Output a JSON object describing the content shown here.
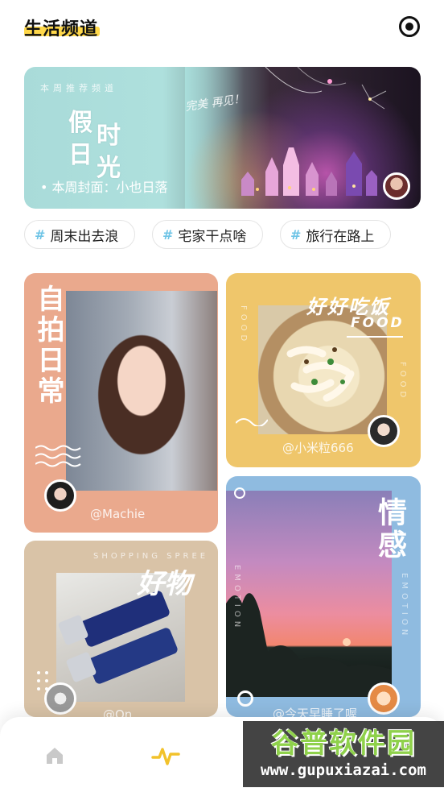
{
  "header": {
    "title": "生活频道",
    "record_icon": "record-icon"
  },
  "banner": {
    "eyebrow": "本周推荐频道",
    "headline_chars": [
      "假",
      "时",
      "日",
      "光"
    ],
    "script": "完美 再见！",
    "caption": "• 本周封面：小也日落"
  },
  "tags": [
    {
      "label": "周末出去浪"
    },
    {
      "label": "宅家干点啥"
    },
    {
      "label": "旅行在路上"
    }
  ],
  "cards": {
    "selfie": {
      "title": "自拍日常",
      "handle": "@Machie",
      "color": "#e9a98c"
    },
    "food": {
      "title": "好好吃饭",
      "subtitle": "FOOD",
      "side_text": "FOOD",
      "handle": "@小米粒666",
      "color": "#efc66a"
    },
    "goods": {
      "title": "好物",
      "subtitle": "SHOPPING SPREE",
      "handle": "@Qn",
      "color": "#d9c2a6"
    },
    "emotion": {
      "title": "情感",
      "side_text": "EMOTION",
      "handle": "@今天早睡了喔",
      "color": "#8ab7dd"
    }
  },
  "nav": {
    "items": [
      {
        "icon": "home-icon",
        "active": false
      },
      {
        "icon": "pulse-icon",
        "active": true
      }
    ]
  },
  "watermark": {
    "cn": "谷普软件园",
    "url": "www.gupuxiazai.com"
  }
}
